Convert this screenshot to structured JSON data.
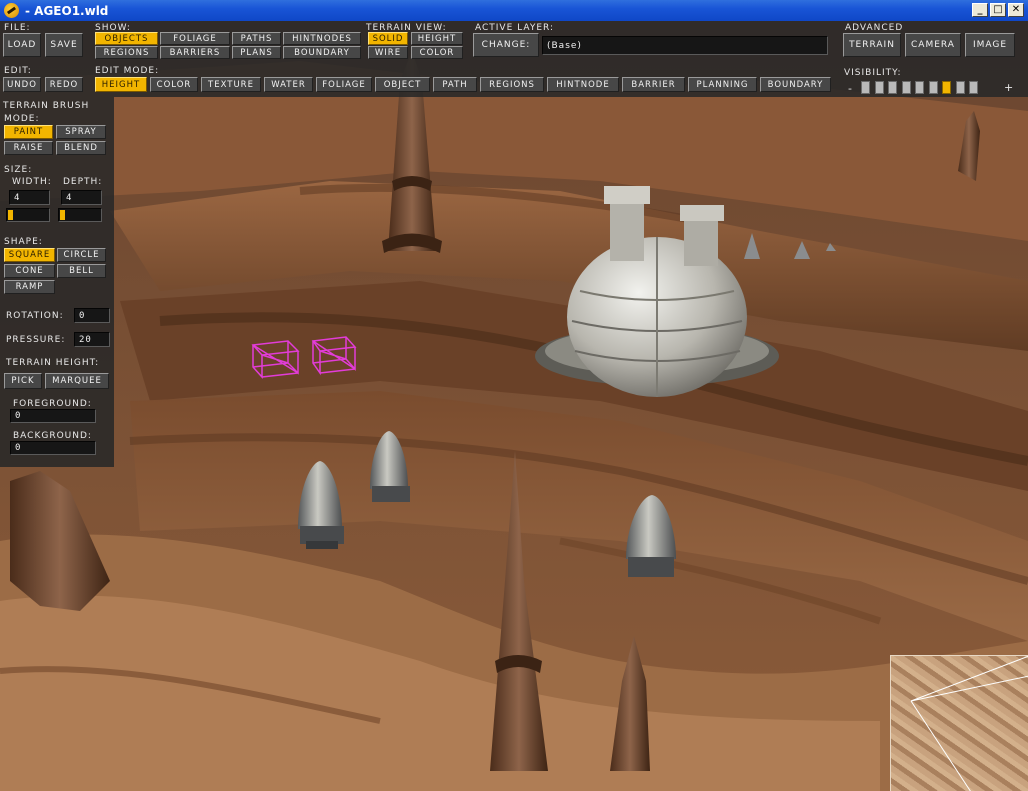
{
  "window": {
    "title": "- AGEO1.wld",
    "min_symbol": "_",
    "max_symbol": "□",
    "close_symbol": "✕"
  },
  "file": {
    "label": "File:",
    "load": "Load",
    "save": "Save"
  },
  "edit": {
    "label": "Edit:",
    "undo": "Undo",
    "redo": "Redo"
  },
  "show": {
    "label": "Show:",
    "items": [
      {
        "label": "Objects",
        "active": true
      },
      {
        "label": "Foliage",
        "active": false
      },
      {
        "label": "Paths",
        "active": false
      },
      {
        "label": "HintNodes",
        "active": false
      },
      {
        "label": "Regions",
        "active": false
      },
      {
        "label": "Barriers",
        "active": false
      },
      {
        "label": "Plans",
        "active": false
      },
      {
        "label": "Boundary",
        "active": false
      }
    ]
  },
  "terrain_view": {
    "label": "Terrain View:",
    "items": [
      {
        "label": "Solid",
        "active": true
      },
      {
        "label": "Height",
        "active": false
      },
      {
        "label": "Wire",
        "active": false
      },
      {
        "label": "Color",
        "active": false
      }
    ]
  },
  "active_layer": {
    "label": "Active Layer:",
    "change": "Change:",
    "value": "(Base)"
  },
  "advanced": {
    "label": "Advanced",
    "terrain": "Terrain",
    "camera": "Camera",
    "image": "Image"
  },
  "visibility": {
    "label": "Visibility:",
    "minus": "-",
    "plus": "+",
    "segments": 9,
    "active_index": 6
  },
  "edit_mode": {
    "label": "Edit Mode:",
    "items": [
      {
        "label": "Height",
        "active": true
      },
      {
        "label": "Color",
        "active": false
      },
      {
        "label": "Texture",
        "active": false
      },
      {
        "label": "Water",
        "active": false
      },
      {
        "label": "Foliage",
        "active": false
      },
      {
        "label": "Object",
        "active": false
      },
      {
        "label": "Path",
        "active": false
      },
      {
        "label": "Regions",
        "active": false
      },
      {
        "label": "HintNode",
        "active": false
      },
      {
        "label": "Barrier",
        "active": false
      },
      {
        "label": "Planning",
        "active": false
      },
      {
        "label": "Boundary",
        "active": false
      }
    ]
  },
  "brush": {
    "title": "Terrain Brush",
    "mode_label": "Mode:",
    "modes": [
      {
        "label": "Paint",
        "active": true
      },
      {
        "label": "Spray",
        "active": false
      },
      {
        "label": "Raise",
        "active": false
      },
      {
        "label": "Blend",
        "active": false
      }
    ],
    "size_label": "Size:",
    "width_label": "Width:",
    "depth_label": "Depth:",
    "width_value": "4",
    "depth_value": "4",
    "shape_label": "Shape:",
    "shapes": [
      {
        "label": "Square",
        "active": true
      },
      {
        "label": "Circle",
        "active": false
      },
      {
        "label": "Cone",
        "active": false
      },
      {
        "label": "Bell",
        "active": false
      },
      {
        "label": "Ramp",
        "active": false
      }
    ],
    "rotation_label": "Rotation:",
    "rotation_value": "0",
    "pressure_label": "Pressure:",
    "pressure_value": "20",
    "terrain_height_label": "Terrain Height:",
    "pick": "Pick",
    "marquee": "Marquee",
    "foreground_label": "Foreground:",
    "foreground_value": "0",
    "background_label": "Background:",
    "background_value": "0"
  },
  "colors": {
    "accent": "#f2b500",
    "panel": "#282828",
    "terrain": "#8a5a38"
  }
}
